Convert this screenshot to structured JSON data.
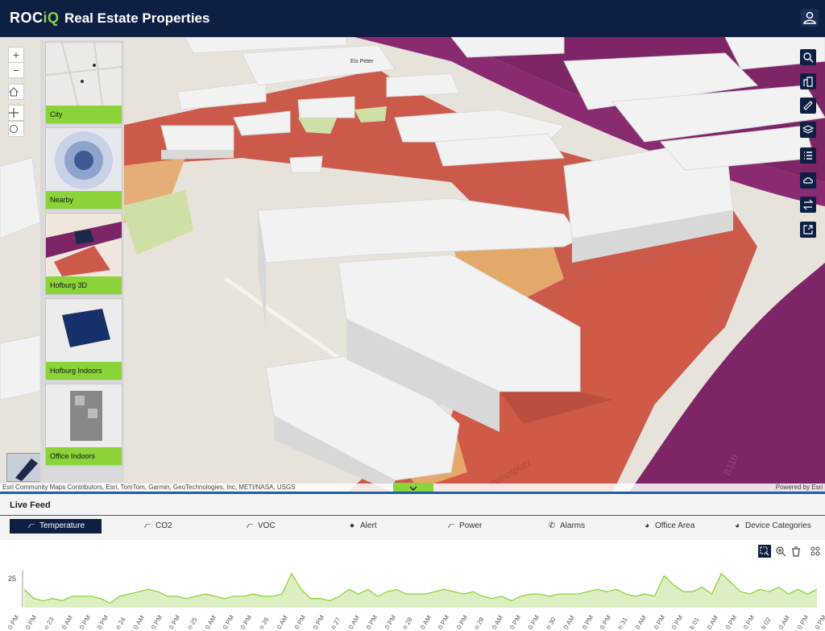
{
  "header": {
    "logo_roc": "ROC",
    "logo_iq": "iQ",
    "title": "Real Estate Properties",
    "user_icon": "user-icon"
  },
  "map": {
    "labels": {
      "eis_peter": "Eis Peter",
      "bahnhofplatz": "Bahnhofplatz",
      "street_b11b": "B11b"
    },
    "zoom_in": "+",
    "zoom_out": "−",
    "tools": [
      "search-icon",
      "buildings-icon",
      "measure-icon",
      "layers-icon",
      "legend-icon",
      "weather-icon",
      "swap-icon",
      "export-icon"
    ],
    "attribution": "Esri Community Maps Contributors, Esri, TomTom, Garmin, GeoTechnologies, Inc, METI/NASA, USGS",
    "powered_by": "Powered by Esri"
  },
  "gallery": {
    "items": [
      {
        "label": "City"
      },
      {
        "label": "Nearby"
      },
      {
        "label": "Hofburg 3D"
      },
      {
        "label": "Hofburg Indoors"
      },
      {
        "label": "Office Indoors"
      }
    ]
  },
  "feed": {
    "title": "Live Feed",
    "tabs": [
      {
        "label": "Temperature",
        "icon": "line-chart-icon"
      },
      {
        "label": "CO2",
        "icon": "line-chart-icon"
      },
      {
        "label": "VOC",
        "icon": "line-chart-icon"
      },
      {
        "label": "Alert",
        "icon": "alert-icon"
      },
      {
        "label": "Power",
        "icon": "line-chart-icon"
      },
      {
        "label": "Alarms",
        "icon": "phone-icon"
      },
      {
        "label": "Office Area",
        "icon": "pie-icon"
      },
      {
        "label": "Device Categories",
        "icon": "pie-icon"
      }
    ],
    "active_tab": "Temperature"
  },
  "chart_data": {
    "type": "area",
    "title": "",
    "xlabel": "",
    "ylabel": "",
    "ytick": [
      25
    ],
    "color": "#8ad43a",
    "fill": "#dcefc2",
    "x_ticks": [
      "0 PM",
      "0 PM",
      "n 23",
      "0 AM",
      "0 PM",
      "0 PM",
      "n 24",
      "0 AM",
      "0 PM",
      "0 PM",
      "n 25",
      "0 AM",
      "0 PM",
      "0 PM",
      "n 26",
      "0 AM",
      "0 PM",
      "0 PM",
      "n 27",
      "0 AM",
      "0 PM",
      "0 PM",
      "n 28",
      "0 AM",
      "0 PM",
      "0 PM",
      "n 29",
      "0 AM",
      "0 PM",
      "0 PM",
      "n 30",
      "0 AM",
      "0 PM",
      "0 PM",
      "n 31",
      "0 AM",
      "0 PM",
      "0 PM",
      "b 01",
      "0 AM",
      "0 PM",
      "0 PM",
      "b 02",
      "0 AM",
      "0 PM",
      "0 PM"
    ],
    "values": [
      24,
      20,
      19,
      20,
      19,
      21,
      21,
      21,
      20,
      18,
      21,
      22,
      23,
      24,
      23,
      21,
      21,
      20,
      21,
      22,
      21,
      20,
      21,
      21,
      22,
      21,
      21,
      22,
      31,
      24,
      20,
      20,
      19,
      21,
      24,
      22,
      24,
      21,
      23,
      24,
      22,
      22,
      22,
      23,
      24,
      23,
      22,
      23,
      21,
      20,
      21,
      19,
      21,
      22,
      22,
      21,
      22,
      22,
      22,
      23,
      24,
      23,
      24,
      22,
      21,
      22,
      21,
      30,
      26,
      23,
      23,
      25,
      22,
      31,
      27,
      23,
      22,
      24,
      23,
      25,
      22,
      24,
      22,
      24
    ],
    "ylim": [
      16,
      33
    ]
  }
}
